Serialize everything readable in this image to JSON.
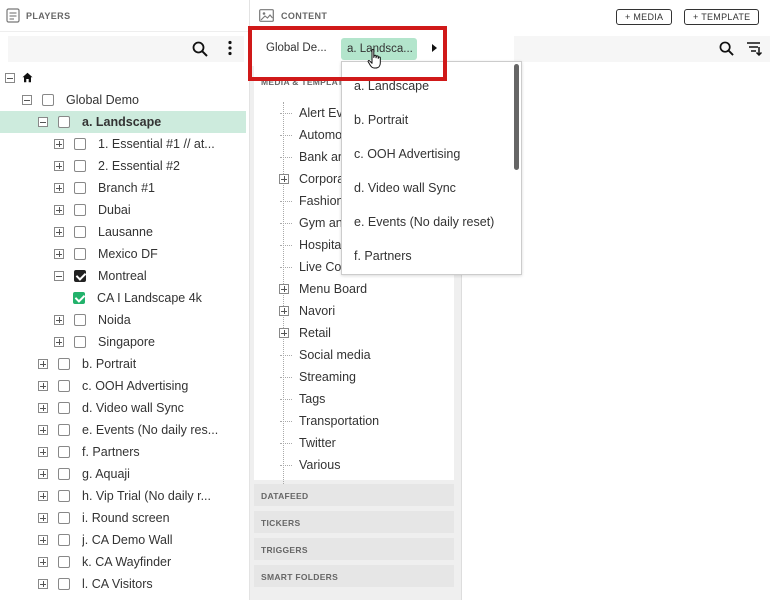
{
  "players": {
    "title": "PLAYERS",
    "tree": [
      {
        "label": "",
        "depth": 0,
        "expander": "minus",
        "checkbox": "off",
        "home": true
      },
      {
        "label": "Global Demo",
        "depth": 1,
        "expander": "minus",
        "checkbox": "off"
      },
      {
        "label": "a. Landscape",
        "depth": 2,
        "expander": "minus",
        "checkbox": "off",
        "selected": true
      },
      {
        "label": "1. Essential #1 // at...",
        "depth": 3,
        "expander": "plus",
        "checkbox": "off"
      },
      {
        "label": "2. Essential #2",
        "depth": 3,
        "expander": "plus",
        "checkbox": "off"
      },
      {
        "label": "Branch #1",
        "depth": 3,
        "expander": "plus",
        "checkbox": "off"
      },
      {
        "label": "Dubai",
        "depth": 3,
        "expander": "plus",
        "checkbox": "off"
      },
      {
        "label": "Lausanne",
        "depth": 3,
        "expander": "plus",
        "checkbox": "off"
      },
      {
        "label": "Mexico DF",
        "depth": 3,
        "expander": "plus",
        "checkbox": "off"
      },
      {
        "label": "Montreal",
        "depth": 3,
        "expander": "minus",
        "checkbox": "on"
      },
      {
        "label": "CA I Landscape 4k",
        "depth": 4,
        "expander": "none",
        "checkbox": "green"
      },
      {
        "label": "Noida",
        "depth": 3,
        "expander": "plus",
        "checkbox": "off"
      },
      {
        "label": "Singapore",
        "depth": 3,
        "expander": "plus",
        "checkbox": "off"
      },
      {
        "label": "b. Portrait",
        "depth": 2,
        "expander": "plus",
        "checkbox": "off"
      },
      {
        "label": "c. OOH Advertising",
        "depth": 2,
        "expander": "plus",
        "checkbox": "off"
      },
      {
        "label": "d. Video wall Sync",
        "depth": 2,
        "expander": "plus",
        "checkbox": "off"
      },
      {
        "label": "e. Events (No daily res...",
        "depth": 2,
        "expander": "plus",
        "checkbox": "off"
      },
      {
        "label": "f. Partners",
        "depth": 2,
        "expander": "plus",
        "checkbox": "off"
      },
      {
        "label": "g. Aquaji",
        "depth": 2,
        "expander": "plus",
        "checkbox": "off"
      },
      {
        "label": "h. Vip Trial (No daily r...",
        "depth": 2,
        "expander": "plus",
        "checkbox": "off"
      },
      {
        "label": "i. Round screen",
        "depth": 2,
        "expander": "plus",
        "checkbox": "off"
      },
      {
        "label": "j. CA Demo Wall",
        "depth": 2,
        "expander": "plus",
        "checkbox": "off"
      },
      {
        "label": "k. CA Wayfinder",
        "depth": 2,
        "expander": "plus",
        "checkbox": "off"
      },
      {
        "label": "l. CA Visitors",
        "depth": 2,
        "expander": "plus",
        "checkbox": "off"
      }
    ]
  },
  "content": {
    "title": "CONTENT",
    "add_media": "+ MEDIA",
    "add_template": "+ TEMPLATE",
    "breadcrumb": {
      "first": "Global De...",
      "current": "a. Landsca..."
    },
    "media_header": "MEDIA & TEMPLATES",
    "media_items": [
      {
        "label": "Alert Eva",
        "expandable": false
      },
      {
        "label": "Automot",
        "expandable": false
      },
      {
        "label": "Bank and",
        "expandable": false
      },
      {
        "label": "Corpora",
        "expandable": true
      },
      {
        "label": "Fashion",
        "expandable": false
      },
      {
        "label": "Gym and",
        "expandable": false
      },
      {
        "label": "Hospital",
        "expandable": false
      },
      {
        "label": "Live Con",
        "expandable": false
      },
      {
        "label": "Menu Board",
        "expandable": true
      },
      {
        "label": "Navori",
        "expandable": true
      },
      {
        "label": "Retail",
        "expandable": true
      },
      {
        "label": "Social media",
        "expandable": false
      },
      {
        "label": "Streaming",
        "expandable": false
      },
      {
        "label": "Tags",
        "expandable": false
      },
      {
        "label": "Transportation",
        "expandable": false
      },
      {
        "label": "Twitter",
        "expandable": false
      },
      {
        "label": "Various",
        "expandable": false
      }
    ],
    "sections": [
      "DATAFEED",
      "TICKERS",
      "TRIGGERS",
      "SMART FOLDERS"
    ]
  },
  "dropdown": {
    "options": [
      "a. Landscape",
      "b. Portrait",
      "c. OOH Advertising",
      "d. Video wall Sync",
      "e. Events (No daily reset)",
      "f. Partners"
    ]
  },
  "colors": {
    "selected_row": "#cdebdd",
    "breadcrumb_current": "#b3e5cc",
    "checkbox_green": "#22b26b",
    "highlight": "#d01919"
  }
}
